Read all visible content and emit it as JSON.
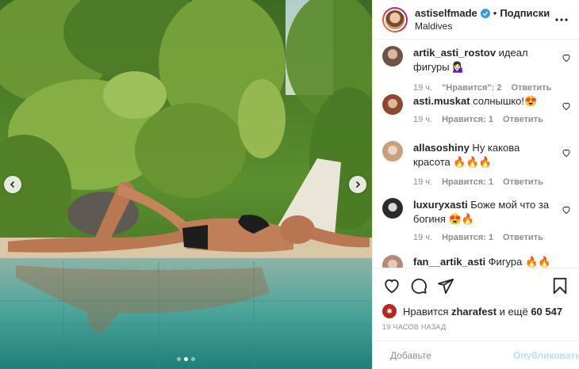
{
  "post": {
    "author": "astiselfmade",
    "location": "Maldives",
    "follow_label": "Подписки",
    "separator": "•"
  },
  "photo": {
    "carousel_dots": 3,
    "active_dot": 2
  },
  "comments": [
    {
      "user": "artik_asti_rostov",
      "text": " идеал фигуры 💁🏻‍♀️",
      "time": "19 ч.",
      "likes": "\"Нравится\": 2",
      "reply": "Ответить",
      "avatar_color": "#6e5347"
    },
    {
      "user": "asti.muskat",
      "text": " солнышко!😍",
      "time": "19 ч.",
      "likes": "Нравится: 1",
      "reply": "Ответить",
      "avatar_color": "#a2664f"
    },
    {
      "user": "allasoshiny",
      "text": " Ну какова красота 🔥🔥🔥",
      "time": "19 ч.",
      "likes": "Нравится: 1",
      "reply": "Ответить",
      "avatar_color": "#c6a07f"
    },
    {
      "user": "luxuryxasti",
      "text": " Боже мой что за богиня 😍🔥",
      "time": "19 ч.",
      "likes": "Нравится: 1",
      "reply": "Ответить",
      "avatar_color": "#3a3a3a"
    },
    {
      "user": "fan__artik_asti",
      "text": " Фигура 🔥🔥🔥",
      "time": "",
      "likes": "",
      "reply": "",
      "avatar_color": "#b58a76"
    }
  ],
  "likes": {
    "prefix": "Нравится ",
    "user": "zharafest",
    "middle": " и ещё ",
    "count": "60 547"
  },
  "timestamp": "19 ЧАСОВ НАЗАД",
  "add_comment": {
    "placeholder": "Добавьте комментарий...",
    "display": "Добавьте",
    "publish_label": "Опубликовать"
  },
  "colors": {
    "accent_link": "#0095f6",
    "publish_disabled": "#b2dffc",
    "verified": "#3897f0"
  }
}
